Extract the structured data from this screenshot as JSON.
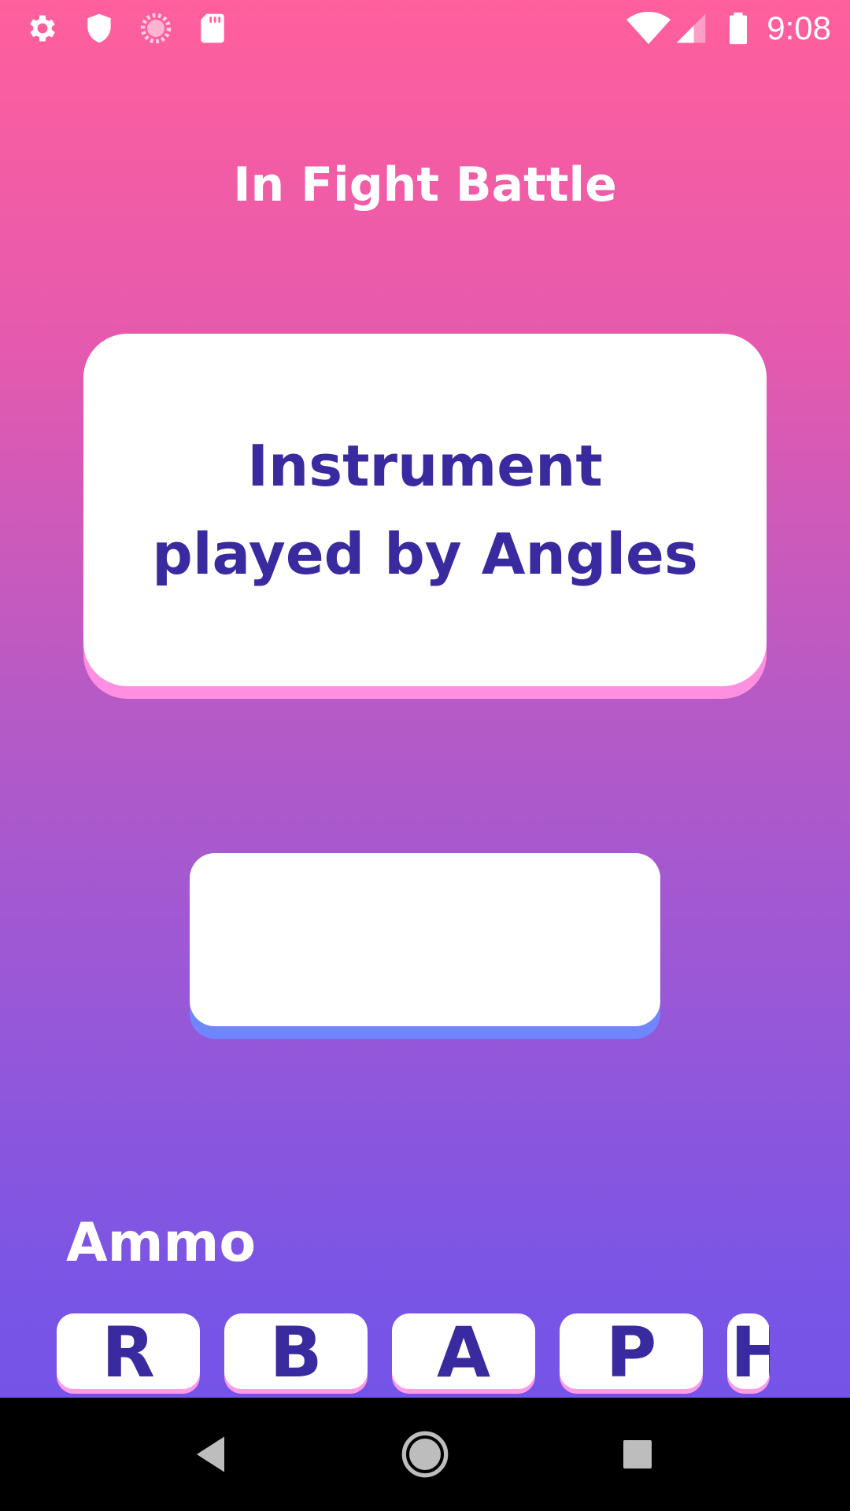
{
  "status_bar": {
    "time": "9:08",
    "left_icons": [
      "gear-icon",
      "shield-icon",
      "loading-icon",
      "sd-card-icon"
    ],
    "right_icons": [
      "wifi-icon",
      "signal-icon",
      "battery-icon"
    ]
  },
  "title": "In Fight Battle",
  "question": {
    "line1": "Instrument",
    "line2": "played by Angles"
  },
  "answer": {
    "value": ""
  },
  "ammo": {
    "label": "Ammo",
    "letters": [
      "R",
      "B",
      "A",
      "P",
      "H"
    ]
  },
  "nav": {
    "buttons": [
      "back",
      "home",
      "recents"
    ]
  },
  "colors": {
    "gradient_top": "#ff5f9c",
    "gradient_bottom": "#6e53ea",
    "text_primary": "#3a2aa0",
    "card_shadow": "#ff8fe0",
    "answer_shadow": "#6f86ff",
    "tile_shadow": "#ff9be6"
  }
}
